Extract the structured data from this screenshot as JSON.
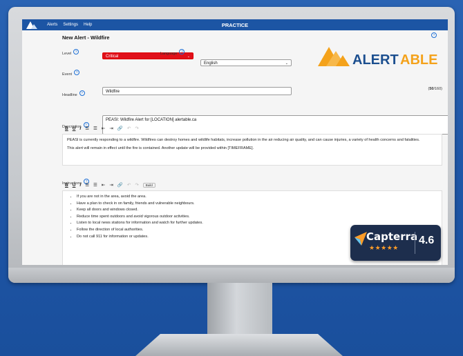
{
  "nav": {
    "items": [
      "Alerts",
      "Settings",
      "Help"
    ],
    "mode": "PRACTICE"
  },
  "page": {
    "title": "New Alert - Wildfire",
    "help_glyph": "?"
  },
  "level": {
    "label": "Level",
    "value": "Critical"
  },
  "language": {
    "label": "Language",
    "value": "English"
  },
  "event": {
    "label": "Event",
    "value": "Wildfire"
  },
  "headline": {
    "label": "Headline",
    "value": "PEASI: Wildfire Alert for [LOCATION]  alertable.ca",
    "count_current": "50",
    "count_max": "/160"
  },
  "description": {
    "label": "Description",
    "paragraphs": [
      "PEASI is currently responding to a wildfire. Wildfires can destroy homes and wildlife habitats, increase pollution in the air reducing air quality, and can cause injuries, a variety of health concerns and fatalities.",
      "This alert will remain in effect until the fire is contained. Another update will be provided within [TIMEFRAME]."
    ]
  },
  "instructions": {
    "label": "Instructions",
    "build_label": "Build",
    "items": [
      "If you are not in the area, avoid the area.",
      "Have a plan to check in on family, friends and vulnerable neighbours.",
      "Keep all doors and windows closed.",
      "Reduce time spent outdoors and avoid vigorous outdoor activities.",
      "Listen to local news stations for information and watch for further updates.",
      "Follow the direction of local authorities.",
      "Do not call 911 for information or updates."
    ]
  },
  "toolbar": {
    "bold": "B",
    "underline": "U",
    "italic": "I"
  },
  "brand": {
    "name_part1": "ALERT",
    "name_part2": "ABLE",
    "color_dark": "#1c4f8f",
    "color_orange": "#f4a21b"
  },
  "capterra": {
    "name": "Capterra",
    "rating": "4.6",
    "stars": 4.6,
    "stars_display": "★★★★★"
  },
  "colors": {
    "nav": "#1c55a4",
    "critical": "#e0101a",
    "background": "#2160b0"
  }
}
